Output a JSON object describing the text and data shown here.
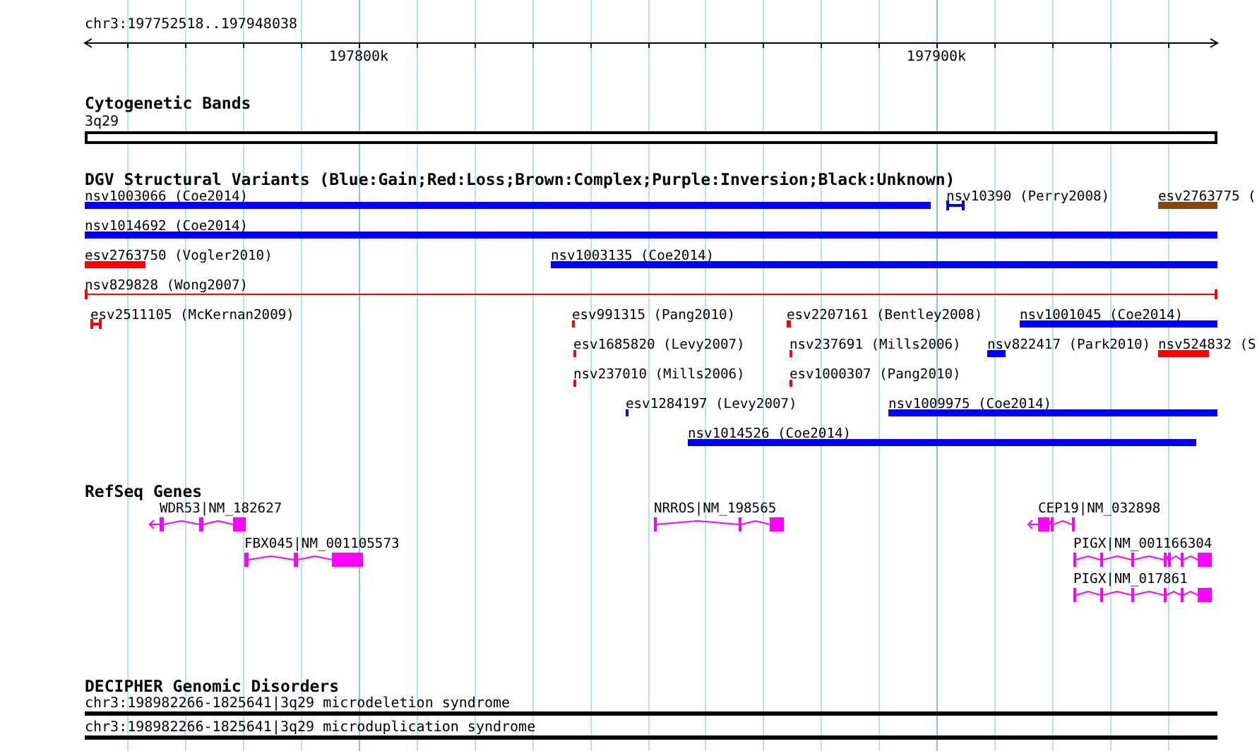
{
  "ruler": {
    "location": "chr3:197752518..197948038",
    "ticks": [
      {
        "label": "197800k"
      },
      {
        "label": "197900k"
      }
    ]
  },
  "cytogenetic_bands": {
    "title": "Cytogenetic Bands",
    "bands": [
      {
        "label": "3q29"
      }
    ]
  },
  "structural_variants": {
    "title": "DGV Structural Variants (Blue:Gain;Red:Loss;Brown:Complex;Purple:Inversion;Black:Unknown)",
    "rows": [
      {
        "features": [
          {
            "label": "nsv1003066 (Coe2014)",
            "color": "#0000ff",
            "kind": "bar"
          },
          {
            "label": "nsv10390 (Perry2008)",
            "color": "#0000ff",
            "kind": "bracket"
          },
          {
            "label": "esv2763775 (",
            "color": "#8b4513",
            "kind": "bar"
          }
        ]
      },
      {
        "features": [
          {
            "label": "nsv1014692 (Coe2014)",
            "color": "#0000ff",
            "kind": "bar"
          }
        ]
      },
      {
        "features": [
          {
            "label": "esv2763750 (Vogler2010)",
            "color": "#ff0000",
            "kind": "bar"
          },
          {
            "label": "nsv1003135 (Coe2014)",
            "color": "#0000ff",
            "kind": "bar"
          }
        ]
      },
      {
        "features": [
          {
            "label": "nsv829828 (Wong2007)",
            "color": "#ff0000",
            "kind": "line"
          }
        ]
      },
      {
        "features": [
          {
            "label": "esv2511105 (McKernan2009)",
            "color": "#ff0000",
            "kind": "bracket"
          },
          {
            "label": "esv991315 (Pang2010)",
            "color": "#ff0000",
            "kind": "bar"
          },
          {
            "label": "esv2207161 (Bentley2008)",
            "color": "#ff0000",
            "kind": "bar"
          },
          {
            "label": "nsv1001045 (Coe2014)",
            "color": "#0000ff",
            "kind": "bar"
          }
        ]
      },
      {
        "features": [
          {
            "label": "esv1685820 (Levy2007)",
            "color": "#ff0000",
            "kind": "bar"
          },
          {
            "label": "nsv237691 (Mills2006)",
            "color": "#ff0000",
            "kind": "bar"
          },
          {
            "label": "nsv822417 (Park2010)",
            "color": "#0000ff",
            "kind": "bar"
          },
          {
            "label": "nsv524832 (S",
            "color": "#ff0000",
            "kind": "bar"
          }
        ]
      },
      {
        "features": [
          {
            "label": "nsv237010 (Mills2006)",
            "color": "#ff0000",
            "kind": "bar"
          },
          {
            "label": "esv1000307 (Pang2010)",
            "color": "#ff0000",
            "kind": "bar"
          }
        ]
      },
      {
        "features": [
          {
            "label": "esv1284197 (Levy2007)",
            "color": "#0000ff",
            "kind": "bar"
          },
          {
            "label": "nsv1009975 (Coe2014)",
            "color": "#0000ff",
            "kind": "bar"
          }
        ]
      },
      {
        "features": [
          {
            "label": "nsv1014526 (Coe2014)",
            "color": "#0000ff",
            "kind": "bar"
          }
        ]
      }
    ]
  },
  "refseq_genes": {
    "title": "RefSeq Genes",
    "rows": [
      {
        "genes": [
          {
            "label": "WDR53|NM_182627",
            "reverse_strand": true
          },
          {
            "label": "NRROS|NM_198565",
            "reverse_strand": false
          },
          {
            "label": "CEP19|NM_032898",
            "reverse_strand": true
          }
        ]
      },
      {
        "genes": [
          {
            "label": "FBX045|NM_001105573",
            "reverse_strand": false
          },
          {
            "label": "PIGX|NM_001166304",
            "reverse_strand": false
          }
        ]
      },
      {
        "genes": [
          {
            "label": "PIGX|NM_017861",
            "reverse_strand": false
          }
        ]
      }
    ]
  },
  "decipher": {
    "title": "DECIPHER Genomic Disorders",
    "entries": [
      {
        "label": "chr3:198982266-1825641|3q29 microdeletion syndrome"
      },
      {
        "label": "chr3:198982266-1825641|3q29 microduplication syndrome"
      }
    ]
  }
}
